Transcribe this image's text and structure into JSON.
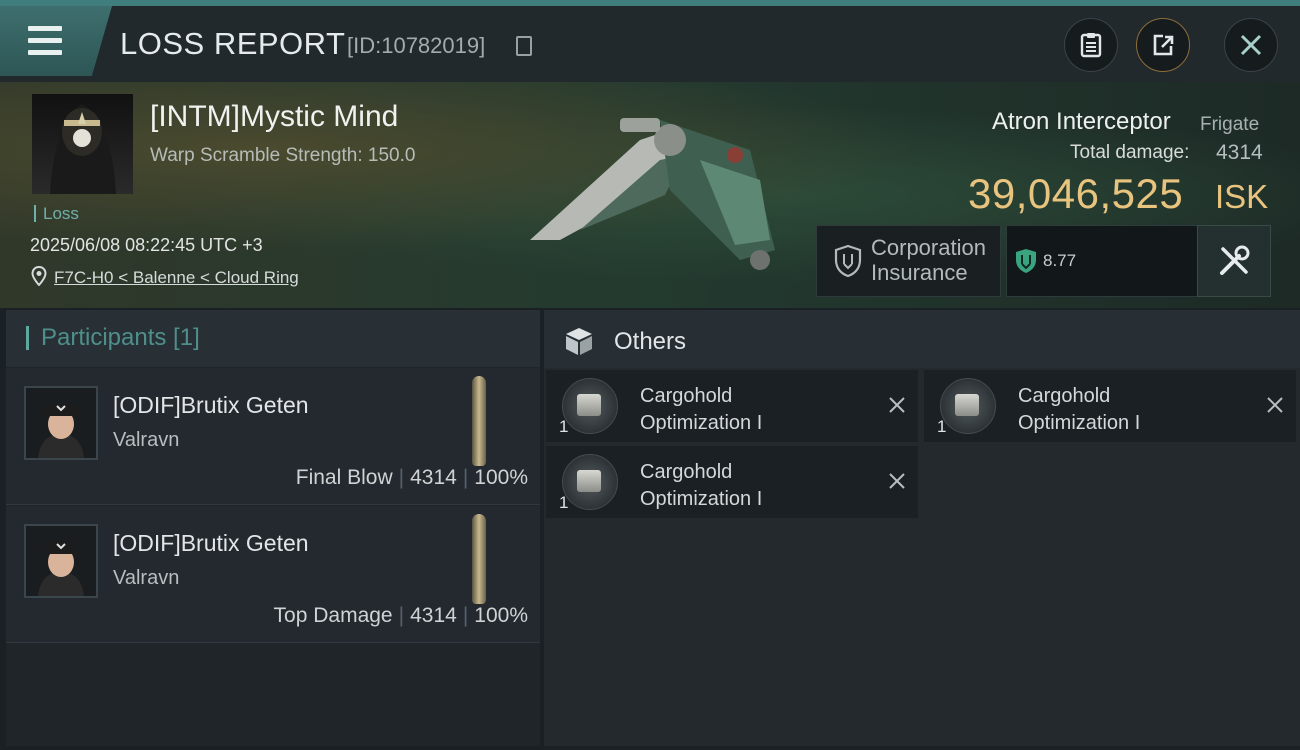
{
  "header": {
    "title": "LOSS REPORT",
    "report_id": "[ID:10782019]",
    "icons": [
      "menu-icon",
      "copy-icon",
      "clipboard-icon",
      "share-icon",
      "close-icon"
    ]
  },
  "victim": {
    "name": "[INTM]Mystic Mind",
    "warp_scramble": "Warp Scramble Strength: 150.0",
    "status": "Loss",
    "datetime": "2025/06/08 08:22:45 UTC +3",
    "location": "F7C-H0 < Balenne < Cloud Ring"
  },
  "ship": {
    "name": "Atron Interceptor",
    "class": "Frigate",
    "total_damage_label": "Total damage:",
    "total_damage_value": "4314",
    "isk_value": "39,046,525",
    "isk_unit": "ISK",
    "insurance_label_1": "Corporation",
    "insurance_label_2": "Insurance",
    "security_value": "8.77"
  },
  "participants": {
    "title": "Participants [1]",
    "list": [
      {
        "name": "[ODIF]Brutix Geten",
        "corp": "Valravn",
        "role": "Final Blow",
        "damage": "4314",
        "percent": "100%"
      },
      {
        "name": "[ODIF]Brutix Geten",
        "corp": "Valravn",
        "role": "Top Damage",
        "damage": "4314",
        "percent": "100%"
      }
    ]
  },
  "others": {
    "title": "Others",
    "items": [
      {
        "qty": "1",
        "name_1": "Cargohold",
        "name_2": "Optimization I"
      },
      {
        "qty": "1",
        "name_1": "Cargohold",
        "name_2": "Optimization I"
      },
      {
        "qty": "1",
        "name_1": "Cargohold",
        "name_2": "Optimization I"
      }
    ]
  },
  "colors": {
    "accent": "#5fa8a2",
    "isk": "#e8c47f"
  }
}
